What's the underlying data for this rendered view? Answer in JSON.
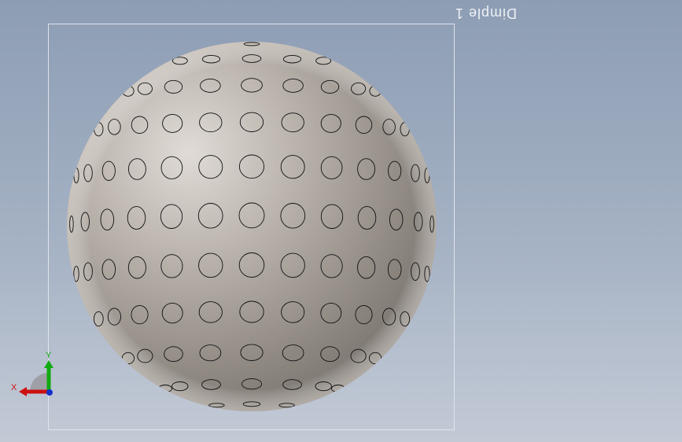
{
  "viewport": {
    "background_top": "#8d9db4",
    "background_bottom": "#c3cad6"
  },
  "model": {
    "shape": "sphere",
    "surface_color": "#b3aca4",
    "outline_color": "#111111",
    "dimple_rows": 9,
    "mirrored_label": "Dimple 1"
  },
  "triad": {
    "x_label": "X",
    "y_label": "Y",
    "x_color": "#cc1111",
    "y_color": "#11aa11",
    "z_color": "#1133cc"
  }
}
